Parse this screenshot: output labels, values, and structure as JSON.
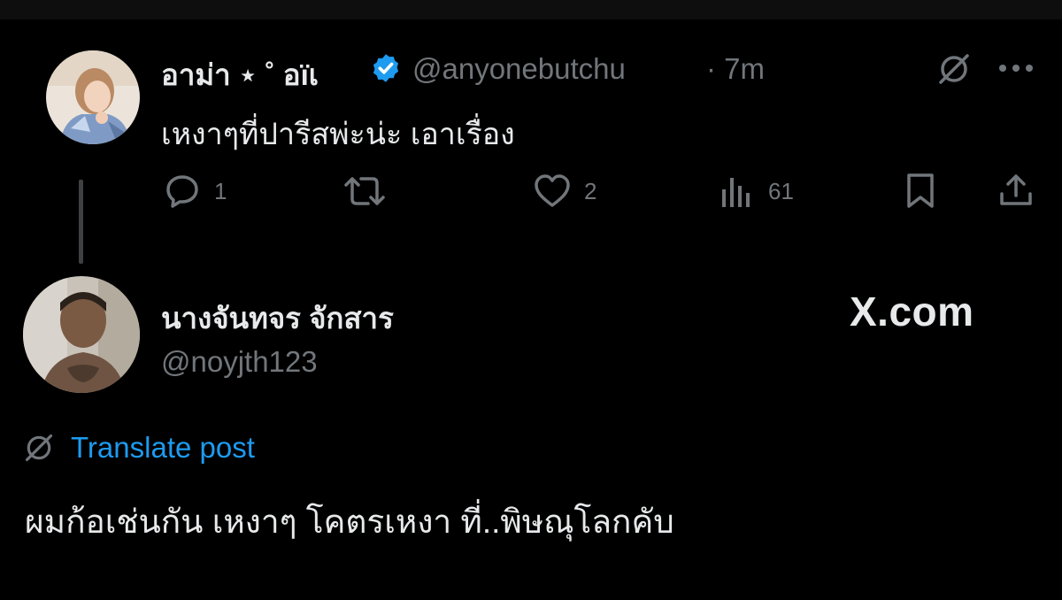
{
  "tweet1": {
    "author_name": "อาม่า ⋆ ˚ อïเ",
    "handle": "@anyonebutchu",
    "time": "· 7m",
    "text": "เหงาๆที่ปารีสพ่ะน่ะ เอาเรื่อง",
    "actions": {
      "reply_count": "1",
      "like_count": "2",
      "views_count": "61"
    }
  },
  "tweet2": {
    "author_name": "นางจันทจร จักสาร",
    "handle": "@noyjth123",
    "translate_label": "Translate post",
    "text": "ผมก้อเช่นกัน   เหงาๆ โคตรเหงา ที่..พิษณุโลกคับ"
  },
  "watermark": "X.com",
  "colors": {
    "background": "#000000",
    "text_primary": "#e7e9ea",
    "text_secondary": "#71767b",
    "accent": "#1d9bf0"
  }
}
